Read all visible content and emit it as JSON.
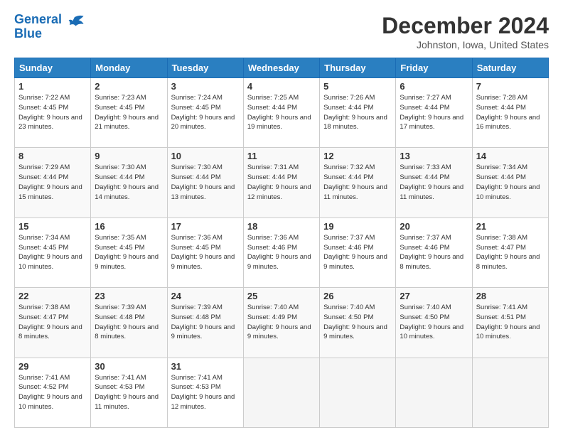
{
  "header": {
    "logo_line1": "General",
    "logo_line2": "Blue",
    "month_title": "December 2024",
    "location": "Johnston, Iowa, United States"
  },
  "weekdays": [
    "Sunday",
    "Monday",
    "Tuesday",
    "Wednesday",
    "Thursday",
    "Friday",
    "Saturday"
  ],
  "weeks": [
    [
      {
        "day": "1",
        "sunrise": "7:22 AM",
        "sunset": "4:45 PM",
        "daylight": "9 hours and 23 minutes."
      },
      {
        "day": "2",
        "sunrise": "7:23 AM",
        "sunset": "4:45 PM",
        "daylight": "9 hours and 21 minutes."
      },
      {
        "day": "3",
        "sunrise": "7:24 AM",
        "sunset": "4:45 PM",
        "daylight": "9 hours and 20 minutes."
      },
      {
        "day": "4",
        "sunrise": "7:25 AM",
        "sunset": "4:44 PM",
        "daylight": "9 hours and 19 minutes."
      },
      {
        "day": "5",
        "sunrise": "7:26 AM",
        "sunset": "4:44 PM",
        "daylight": "9 hours and 18 minutes."
      },
      {
        "day": "6",
        "sunrise": "7:27 AM",
        "sunset": "4:44 PM",
        "daylight": "9 hours and 17 minutes."
      },
      {
        "day": "7",
        "sunrise": "7:28 AM",
        "sunset": "4:44 PM",
        "daylight": "9 hours and 16 minutes."
      }
    ],
    [
      {
        "day": "8",
        "sunrise": "7:29 AM",
        "sunset": "4:44 PM",
        "daylight": "9 hours and 15 minutes."
      },
      {
        "day": "9",
        "sunrise": "7:30 AM",
        "sunset": "4:44 PM",
        "daylight": "9 hours and 14 minutes."
      },
      {
        "day": "10",
        "sunrise": "7:30 AM",
        "sunset": "4:44 PM",
        "daylight": "9 hours and 13 minutes."
      },
      {
        "day": "11",
        "sunrise": "7:31 AM",
        "sunset": "4:44 PM",
        "daylight": "9 hours and 12 minutes."
      },
      {
        "day": "12",
        "sunrise": "7:32 AM",
        "sunset": "4:44 PM",
        "daylight": "9 hours and 11 minutes."
      },
      {
        "day": "13",
        "sunrise": "7:33 AM",
        "sunset": "4:44 PM",
        "daylight": "9 hours and 11 minutes."
      },
      {
        "day": "14",
        "sunrise": "7:34 AM",
        "sunset": "4:44 PM",
        "daylight": "9 hours and 10 minutes."
      }
    ],
    [
      {
        "day": "15",
        "sunrise": "7:34 AM",
        "sunset": "4:45 PM",
        "daylight": "9 hours and 10 minutes."
      },
      {
        "day": "16",
        "sunrise": "7:35 AM",
        "sunset": "4:45 PM",
        "daylight": "9 hours and 9 minutes."
      },
      {
        "day": "17",
        "sunrise": "7:36 AM",
        "sunset": "4:45 PM",
        "daylight": "9 hours and 9 minutes."
      },
      {
        "day": "18",
        "sunrise": "7:36 AM",
        "sunset": "4:46 PM",
        "daylight": "9 hours and 9 minutes."
      },
      {
        "day": "19",
        "sunrise": "7:37 AM",
        "sunset": "4:46 PM",
        "daylight": "9 hours and 9 minutes."
      },
      {
        "day": "20",
        "sunrise": "7:37 AM",
        "sunset": "4:46 PM",
        "daylight": "9 hours and 8 minutes."
      },
      {
        "day": "21",
        "sunrise": "7:38 AM",
        "sunset": "4:47 PM",
        "daylight": "9 hours and 8 minutes."
      }
    ],
    [
      {
        "day": "22",
        "sunrise": "7:38 AM",
        "sunset": "4:47 PM",
        "daylight": "9 hours and 8 minutes."
      },
      {
        "day": "23",
        "sunrise": "7:39 AM",
        "sunset": "4:48 PM",
        "daylight": "9 hours and 8 minutes."
      },
      {
        "day": "24",
        "sunrise": "7:39 AM",
        "sunset": "4:48 PM",
        "daylight": "9 hours and 9 minutes."
      },
      {
        "day": "25",
        "sunrise": "7:40 AM",
        "sunset": "4:49 PM",
        "daylight": "9 hours and 9 minutes."
      },
      {
        "day": "26",
        "sunrise": "7:40 AM",
        "sunset": "4:50 PM",
        "daylight": "9 hours and 9 minutes."
      },
      {
        "day": "27",
        "sunrise": "7:40 AM",
        "sunset": "4:50 PM",
        "daylight": "9 hours and 10 minutes."
      },
      {
        "day": "28",
        "sunrise": "7:41 AM",
        "sunset": "4:51 PM",
        "daylight": "9 hours and 10 minutes."
      }
    ],
    [
      {
        "day": "29",
        "sunrise": "7:41 AM",
        "sunset": "4:52 PM",
        "daylight": "9 hours and 10 minutes."
      },
      {
        "day": "30",
        "sunrise": "7:41 AM",
        "sunset": "4:53 PM",
        "daylight": "9 hours and 11 minutes."
      },
      {
        "day": "31",
        "sunrise": "7:41 AM",
        "sunset": "4:53 PM",
        "daylight": "9 hours and 12 minutes."
      },
      null,
      null,
      null,
      null
    ]
  ]
}
